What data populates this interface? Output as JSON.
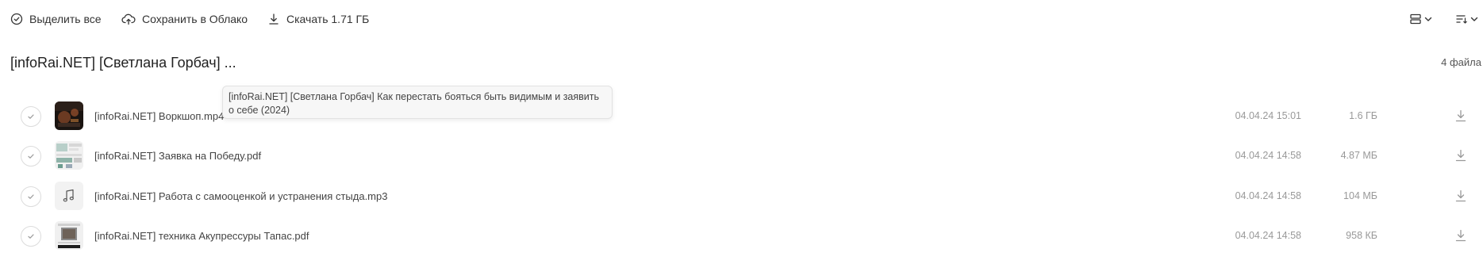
{
  "toolbar": {
    "select_all": "Выделить все",
    "save_cloud": "Сохранить в Облако",
    "download": "Скачать 1.71 ГБ"
  },
  "folder": {
    "title": "[infoRai.NET] [Светлана Горбач] ...",
    "count": "4 файла"
  },
  "tooltip": {
    "text": "[infoRai.NET] [Светлана Горбач] Как перестать бояться быть видимым и заявить о себе (2024)"
  },
  "files": [
    {
      "name": "[infoRai.NET] Воркшоп.mp4",
      "date": "04.04.24 15:01",
      "size": "1.6 ГБ",
      "thumb": "video-thumbnail"
    },
    {
      "name": "[infoRai.NET] Заявка на Победу.pdf",
      "date": "04.04.24 14:58",
      "size": "4.87 МБ",
      "thumb": "pdf-thumbnail"
    },
    {
      "name": "[infoRai.NET] Работа с самооценкой и устранения стыда.mp3",
      "date": "04.04.24 14:58",
      "size": "104 МБ",
      "thumb": "music-note-icon"
    },
    {
      "name": "[infoRai.NET] техника Акупрессуры Тапас.pdf",
      "date": "04.04.24 14:58",
      "size": "958 КБ",
      "thumb": "pdf-thumbnail"
    }
  ],
  "colors": {
    "text_primary": "#222222",
    "text_secondary": "#999999",
    "border": "#dcdcdc",
    "tooltip_bg": "#f7f7f7"
  }
}
